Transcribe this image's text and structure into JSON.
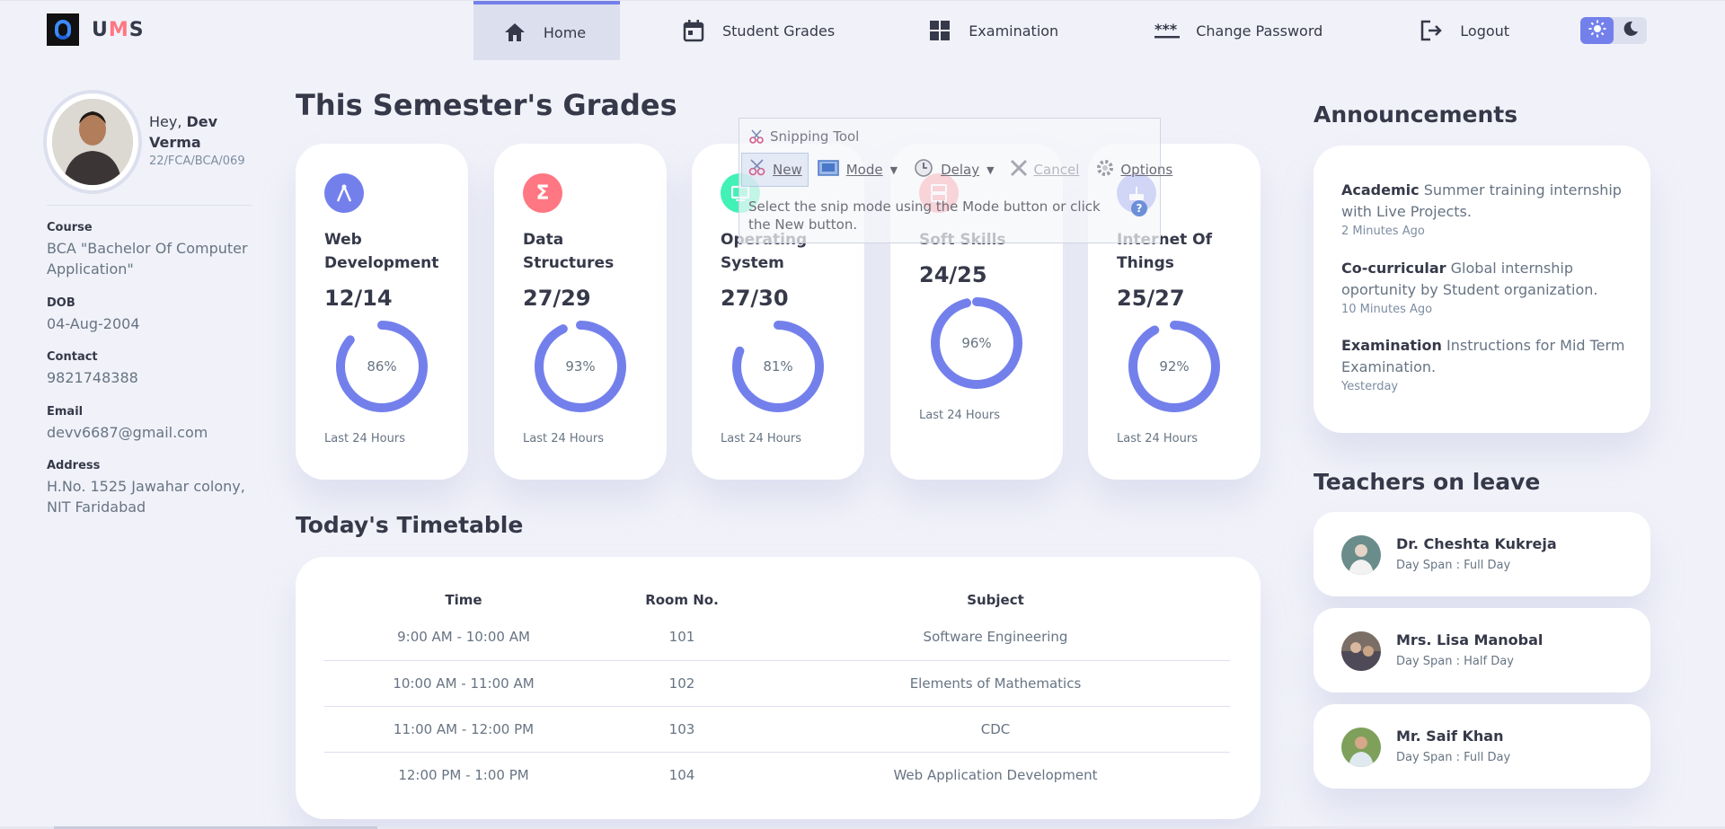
{
  "app": {
    "logo_u": "U",
    "logo_m": "M",
    "logo_s": "S"
  },
  "nav": {
    "home": "Home",
    "student_grades": "Student Grades",
    "examination": "Examination",
    "change_password": "Change Password",
    "logout": "Logout"
  },
  "profile": {
    "greeting": "Hey, ",
    "name": "Dev Verma",
    "roll": "22/FCA/BCA/069",
    "course_label": "Course",
    "course": "BCA \"Bachelor Of Computer Application\"",
    "dob_label": "DOB",
    "dob": "04-Aug-2004",
    "contact_label": "Contact",
    "contact": "9821748388",
    "email_label": "Email",
    "email": "devv6687@gmail.com",
    "address_label": "Address",
    "address": "H.No. 1525 Jawahar colony, NIT Faridabad"
  },
  "grades": {
    "heading": "This Semester's Grades",
    "subjects": [
      {
        "name": "Web Development",
        "score": "12/14",
        "percent": "86%",
        "fraction": 0.86,
        "caption": "Last 24 Hours",
        "color": "#7380ec",
        "icon": "compass-icon"
      },
      {
        "name": "Data Structures",
        "score": "27/29",
        "percent": "93%",
        "fraction": 0.93,
        "caption": "Last 24 Hours",
        "color": "#ff7782",
        "icon": "sigma-icon"
      },
      {
        "name": "Operating System",
        "score": "27/30",
        "percent": "81%",
        "fraction": 0.81,
        "caption": "Last 24 Hours",
        "color": "#41f1b6",
        "icon": "computer-icon"
      },
      {
        "name": "Soft Skills",
        "score": "24/25",
        "percent": "96%",
        "fraction": 0.96,
        "caption": "Last 24 Hours",
        "color": "#ff7782",
        "icon": "dns-icon"
      },
      {
        "name": "Internet Of Things",
        "score": "25/27",
        "percent": "92%",
        "fraction": 0.92,
        "caption": "Last 24 Hours",
        "color": "#7380ec",
        "icon": "router-icon"
      }
    ]
  },
  "timetable": {
    "heading": "Today's Timetable",
    "columns": [
      "Time",
      "Room No.",
      "Subject"
    ],
    "rows": [
      [
        "9:00 AM - 10:00 AM",
        "101",
        "Software Engineering"
      ],
      [
        "10:00 AM - 11:00 AM",
        "102",
        "Elements of Mathematics"
      ],
      [
        "11:00 AM - 12:00 PM",
        "103",
        "CDC"
      ],
      [
        "12:00 PM - 1:00 PM",
        "104",
        "Web Application Development"
      ]
    ]
  },
  "announcements": {
    "heading": "Announcements",
    "items": [
      {
        "tag": "Academic",
        "text": " Summer training internship with Live Projects.",
        "time": "2 Minutes Ago"
      },
      {
        "tag": "Co-curricular",
        "text": " Global internship oportunity by Student organization.",
        "time": "10 Minutes Ago"
      },
      {
        "tag": "Examination",
        "text": " Instructions for Mid Term Examination.",
        "time": "Yesterday"
      }
    ]
  },
  "leave": {
    "heading": "Teachers on leave",
    "items": [
      {
        "name": "Dr. Cheshta Kukreja",
        "span": "Day Span : Full Day"
      },
      {
        "name": "Mrs. Lisa Manobal",
        "span": "Day Span : Half Day"
      },
      {
        "name": "Mr. Saif Khan",
        "span": "Day Span : Full Day"
      }
    ]
  },
  "snipping_tool": {
    "title": "Snipping Tool",
    "new": "New",
    "mode": "Mode",
    "delay": "Delay",
    "cancel": "Cancel",
    "options": "Options",
    "message": "Select the snip mode using the Mode button or click the New button."
  },
  "colors": {
    "primary": "#7380ec",
    "danger": "#ff7782",
    "success": "#41f1b6",
    "background": "#f1f2f9"
  }
}
